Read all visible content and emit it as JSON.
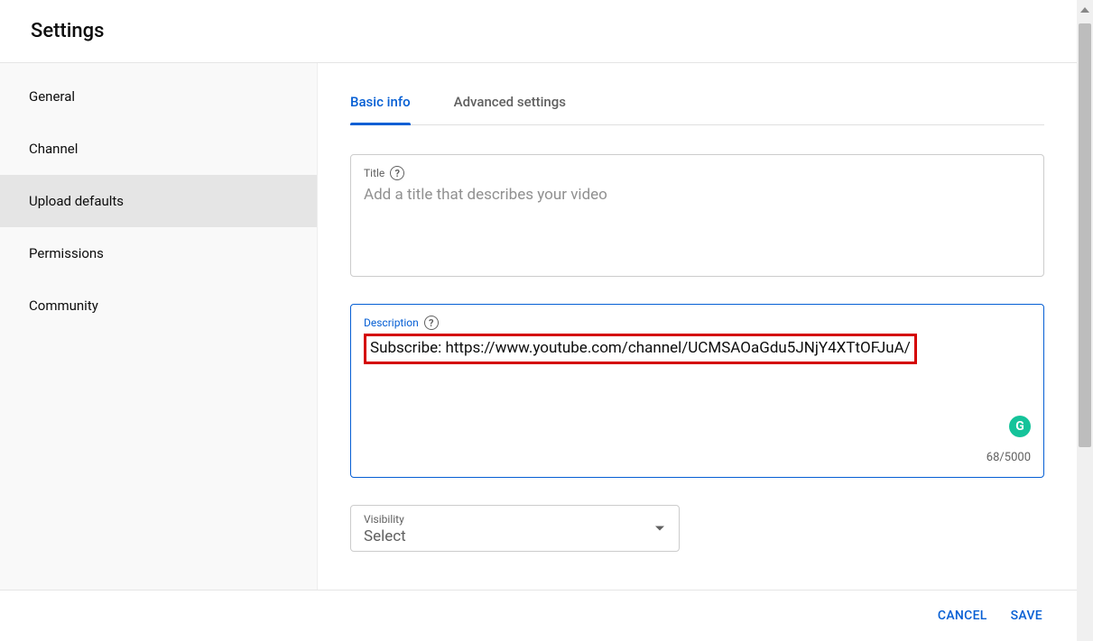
{
  "header": {
    "title": "Settings"
  },
  "sidebar": {
    "items": [
      {
        "label": "General"
      },
      {
        "label": "Channel"
      },
      {
        "label": "Upload defaults"
      },
      {
        "label": "Permissions"
      },
      {
        "label": "Community"
      }
    ]
  },
  "tabs": [
    {
      "label": "Basic info"
    },
    {
      "label": "Advanced settings"
    }
  ],
  "fields": {
    "title": {
      "label": "Title",
      "placeholder": "Add a title that describes your video",
      "value": ""
    },
    "description": {
      "label": "Description",
      "value": "Subscribe: https://www.youtube.com/channel/UCMSAOaGdu5JNjY4XTtOFJuA/",
      "char_count": "68/5000"
    },
    "visibility": {
      "label": "Visibility",
      "value": "Select"
    }
  },
  "footer": {
    "cancel": "CANCEL",
    "save": "SAVE"
  },
  "icons": {
    "help": "?",
    "grammarly": "G"
  }
}
